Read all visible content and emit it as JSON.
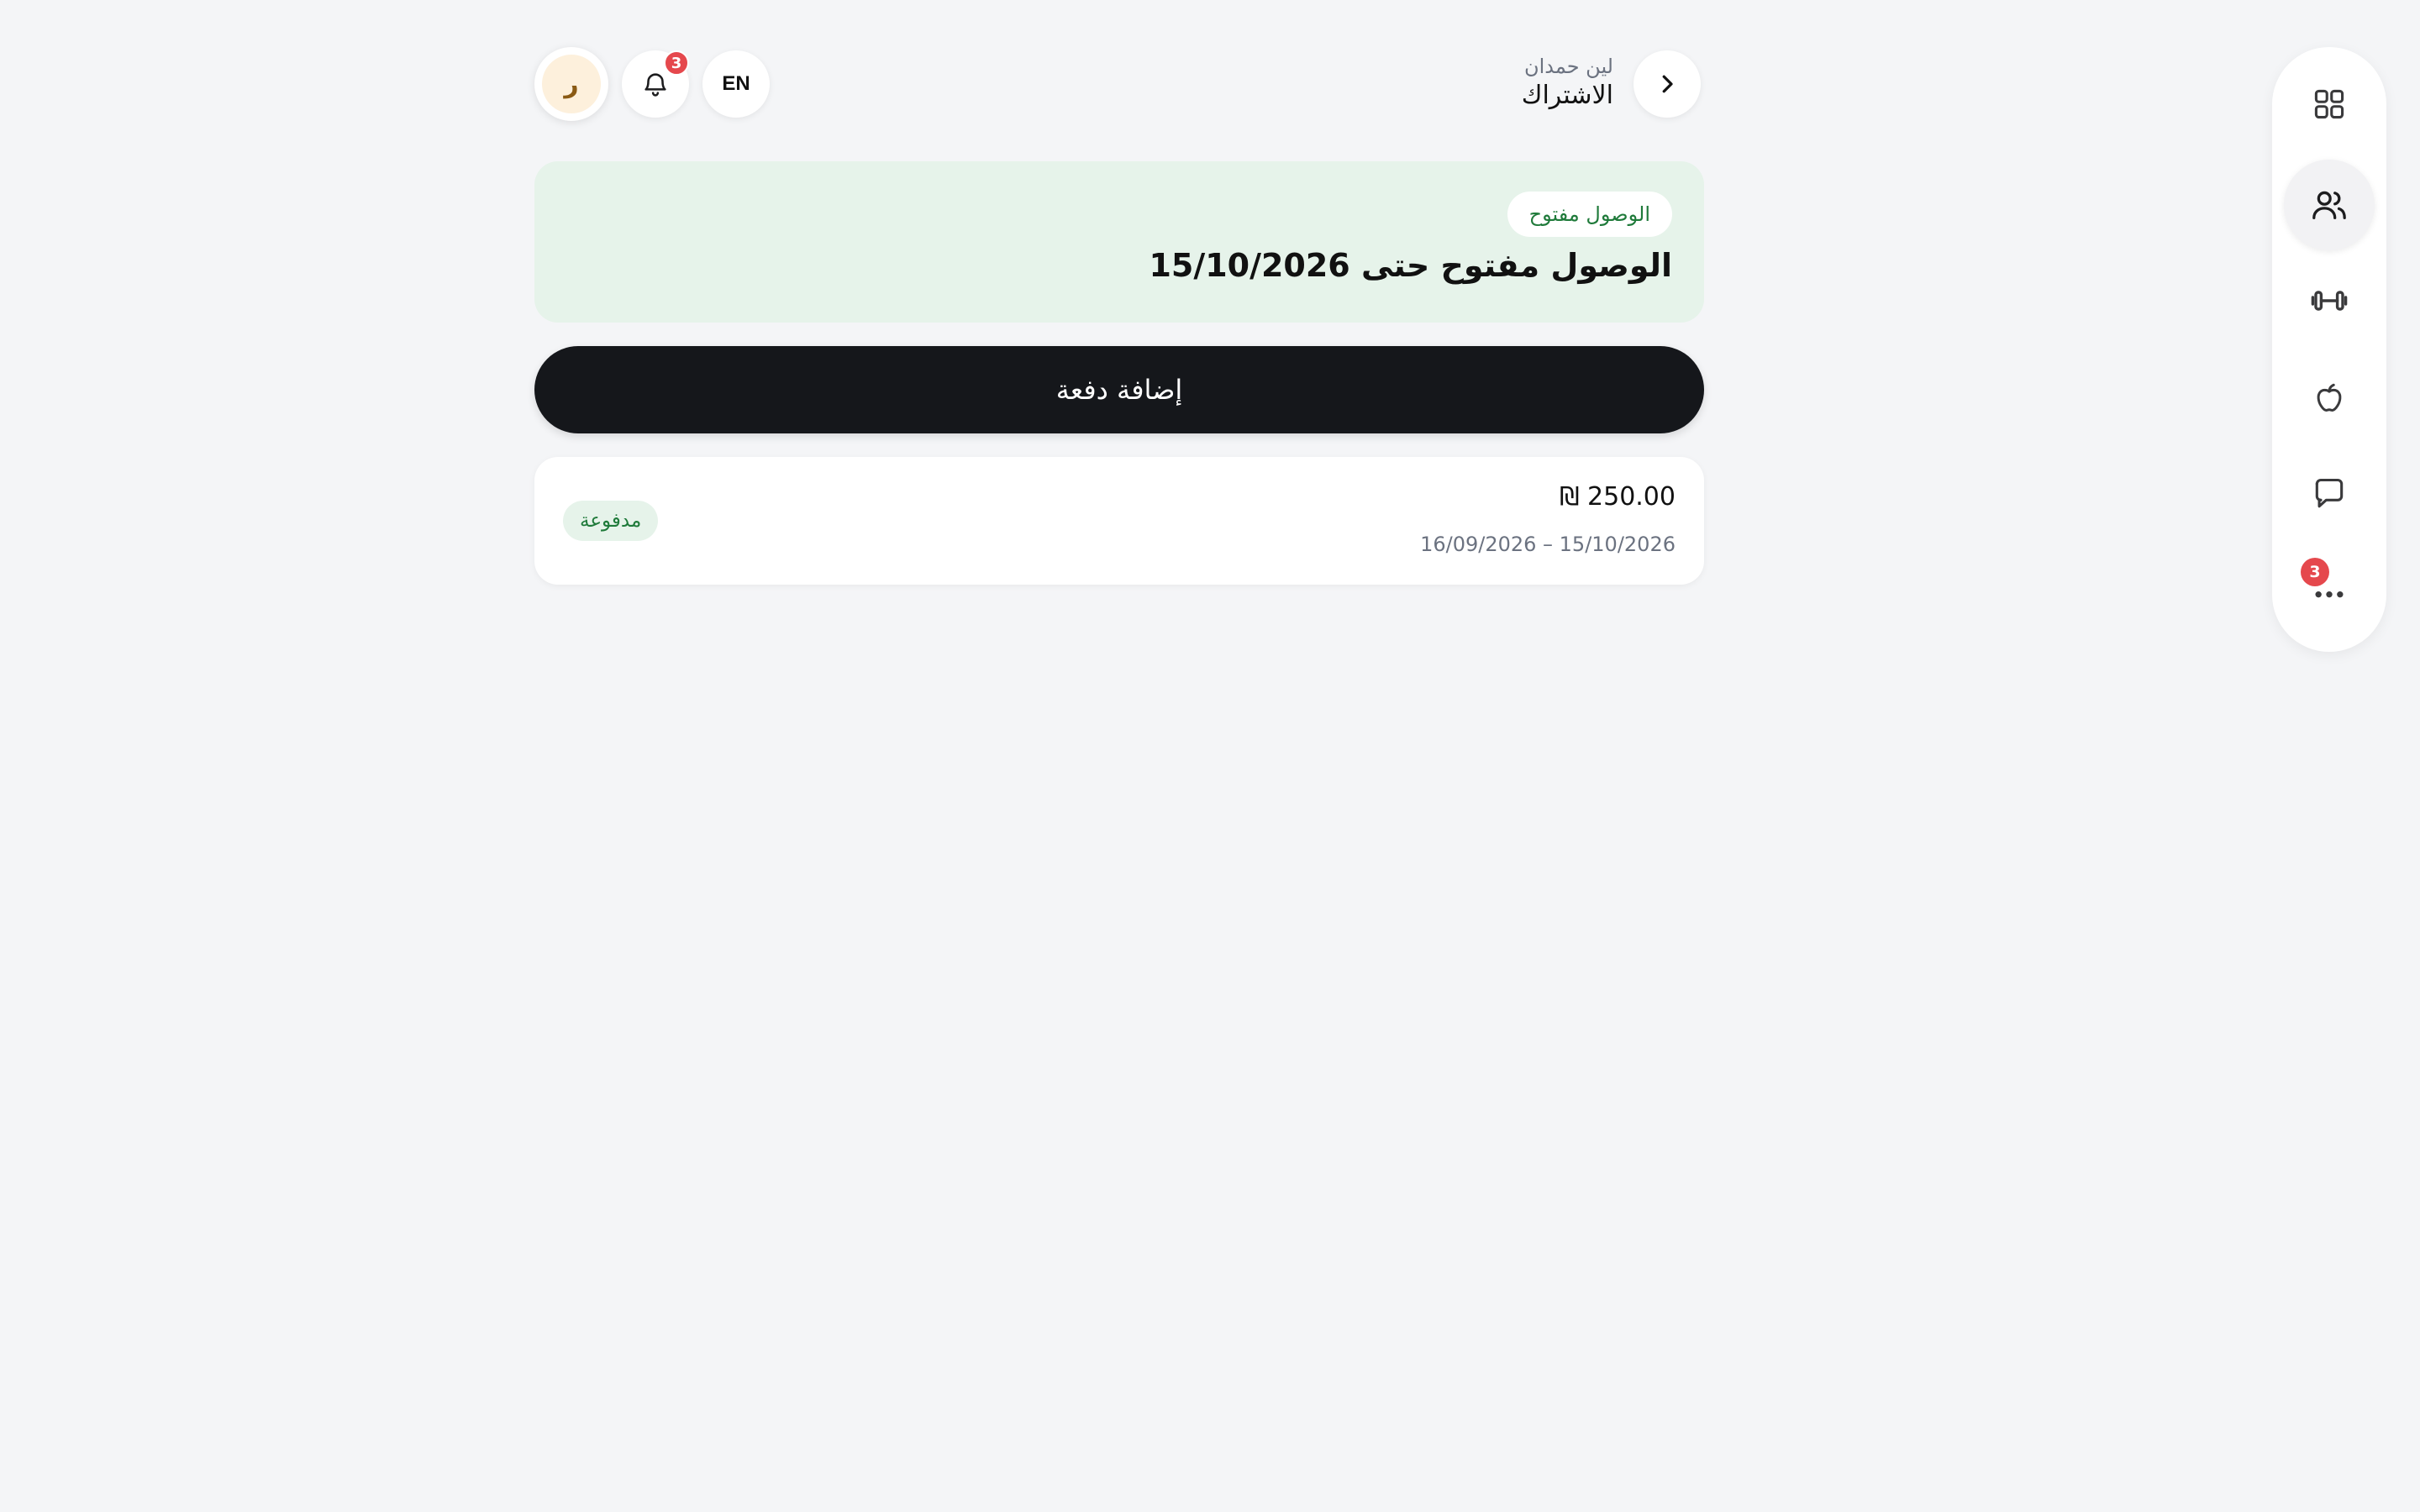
{
  "header": {
    "user_name": "لين حمدان",
    "page_title": "الاشتراك",
    "language_label": "EN",
    "notification_count": "3",
    "avatar_initial": "ر"
  },
  "access": {
    "pill_label": "الوصول مفتوح",
    "heading": "الوصول مفتوح حتى 15/10/2026"
  },
  "actions": {
    "add_payment_label": "إضافة دفعة"
  },
  "payments": [
    {
      "amount": "₪ 250.00",
      "period": "16/09/2026 – 15/10/2026",
      "status": "مدفوعة"
    }
  ],
  "rail": {
    "items": [
      {
        "icon": "grid-icon",
        "active": false
      },
      {
        "icon": "users-icon",
        "active": true
      },
      {
        "icon": "dumbbell-icon",
        "active": false
      },
      {
        "icon": "apple-icon",
        "active": false
      },
      {
        "icon": "chat-icon",
        "active": false
      },
      {
        "icon": "more-icon",
        "active": false
      }
    ],
    "more_badge": "3"
  },
  "colors": {
    "background": "#f4f5f7",
    "access_card_bg": "#e6f3ea",
    "success_text": "#1f7a3a",
    "primary_button": "#15171b",
    "badge_red": "#e5484d"
  }
}
